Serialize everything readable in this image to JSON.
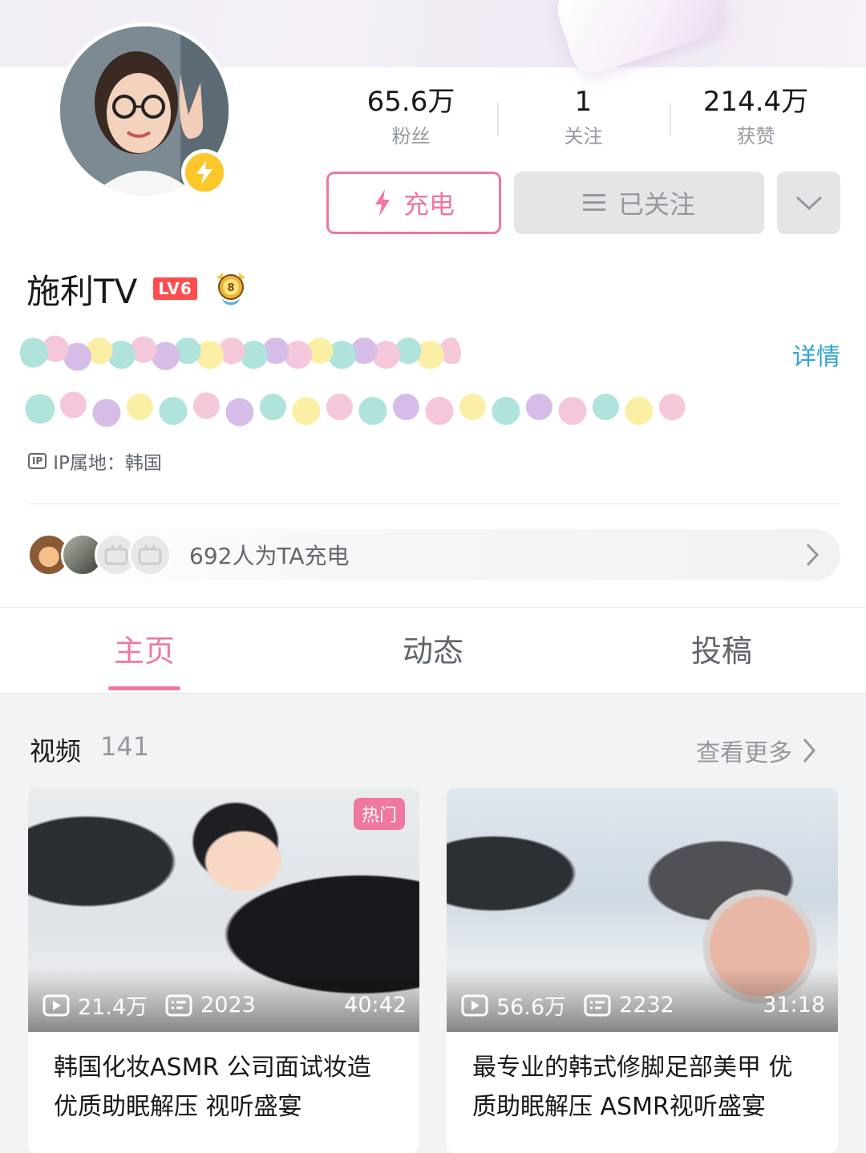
{
  "profile": {
    "name": "施利TV",
    "level": "LV6",
    "stats": [
      {
        "value": "65.6万",
        "label": "粉丝"
      },
      {
        "value": "1",
        "label": "关注"
      },
      {
        "value": "214.4万",
        "label": "获赞"
      }
    ],
    "charge_button": "充电",
    "follow_button": "已关注",
    "detail_link": "详情",
    "ip_icon": "IP",
    "ip_location": "IP属地：韩国"
  },
  "supporters": {
    "text": "692人为TA充电"
  },
  "tabs": [
    {
      "label": "主页",
      "active": true
    },
    {
      "label": "动态",
      "active": false
    },
    {
      "label": "投稿",
      "active": false
    }
  ],
  "videos_section": {
    "title": "视频",
    "count": "141",
    "see_more": "查看更多"
  },
  "videos": [
    {
      "badge": "热门",
      "views": "21.4万",
      "comments": "2023",
      "duration": "40:42",
      "title": "韩国化妆ASMR 公司面试妆造 优质助眠解压 视听盛宴"
    },
    {
      "views": "56.6万",
      "comments": "2232",
      "duration": "31:18",
      "title": "最专业的韩式修脚足部美甲 优质助眠解压 ASMR视听盛宴"
    }
  ],
  "colors": {
    "accent_pink": "#f0779e",
    "link_blue": "#2fa5d2",
    "charge_yellow": "#fcc72a",
    "level_red": "#ff4d4f"
  }
}
